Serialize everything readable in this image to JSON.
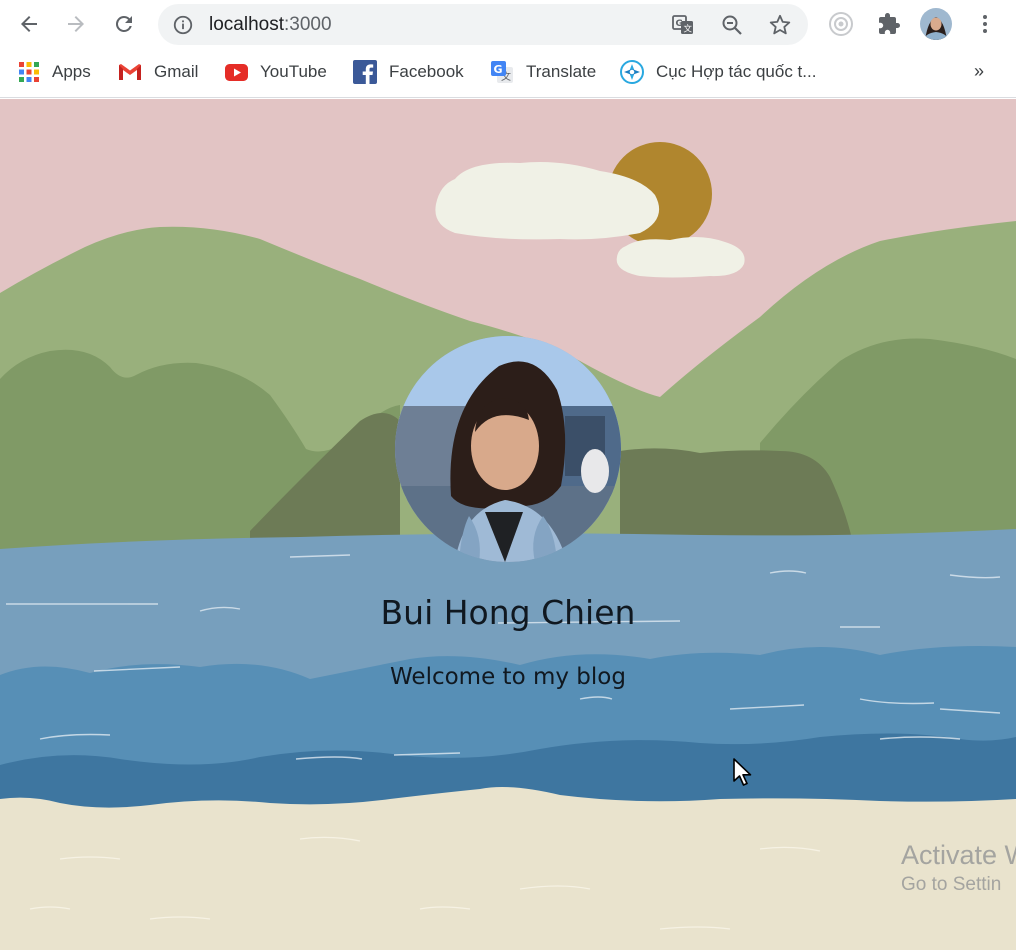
{
  "browser": {
    "url_host": "localhost",
    "url_port": ":3000",
    "icons": {
      "back": "arrow-left-icon",
      "forward": "arrow-right-icon",
      "reload": "reload-icon",
      "info": "info-icon",
      "translate": "translate-icon",
      "zoom": "zoom-out-icon",
      "bookmark": "star-icon",
      "extension1": "circle-extension-icon",
      "extensions": "puzzle-icon",
      "profile": "profile-avatar",
      "menu": "kebab-menu-icon"
    }
  },
  "bookmarks": {
    "items": [
      {
        "label": "Apps",
        "icon": "apps-grid-icon"
      },
      {
        "label": "Gmail",
        "icon": "gmail-icon"
      },
      {
        "label": "YouTube",
        "icon": "youtube-icon"
      },
      {
        "label": "Facebook",
        "icon": "facebook-icon"
      },
      {
        "label": "Translate",
        "icon": "google-translate-icon"
      },
      {
        "label": "Cục Hợp tác quốc t...",
        "icon": "agency-logo-icon"
      }
    ],
    "more": "»"
  },
  "hero": {
    "name": "Bui Hong Chien",
    "tagline": "Welcome to my blog"
  },
  "os_overlay": {
    "line1": "Activate W",
    "line2": "Go to Settin"
  },
  "colors": {
    "sky": "#e2c4c4",
    "sun": "#b0862e",
    "cloud": "#f0f1e6",
    "hill_far": "#99b07c",
    "hill_mid": "#809a66",
    "hill_dark": "#6d7b56",
    "water_light": "#779fbd",
    "water_mid": "#578fb6",
    "water_dark": "#3e76a0",
    "sand": "#e9e3cd",
    "text": "#101820"
  }
}
